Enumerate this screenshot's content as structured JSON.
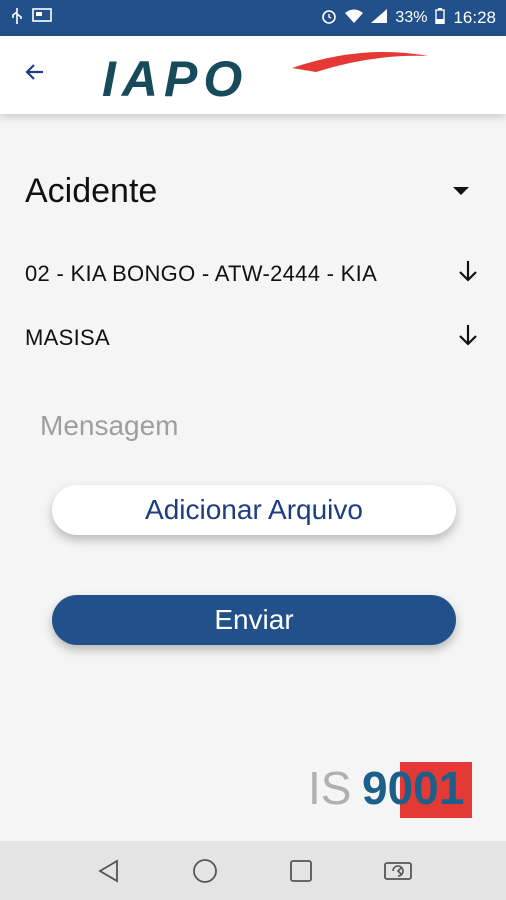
{
  "status_bar": {
    "battery": "33%",
    "time": "16:28",
    "icons": [
      "usb-icon",
      "screen-cast-icon",
      "alarm-icon",
      "wifi-icon",
      "signal-icon",
      "battery-icon"
    ]
  },
  "header": {
    "back_icon": "arrow-left-icon",
    "logo_text": "IAPO"
  },
  "form": {
    "type_value": "Acidente",
    "vehicle_value": "02 - KIA BONGO - ATW-2444 - KIA",
    "client_value": "MASISA",
    "message_placeholder": "Mensagem"
  },
  "buttons": {
    "add_file_label": "Adicionar Arquivo",
    "send_label": "Enviar"
  },
  "iso_logo": {
    "text": "ISO 9001"
  },
  "nav_bar": {
    "icons": [
      "back-triangle-icon",
      "home-circle-icon",
      "recents-square-icon",
      "rotate-icon"
    ]
  },
  "colors": {
    "primary": "#22508a",
    "accent_red": "#e53935",
    "logo_teal": "#174a5a"
  }
}
